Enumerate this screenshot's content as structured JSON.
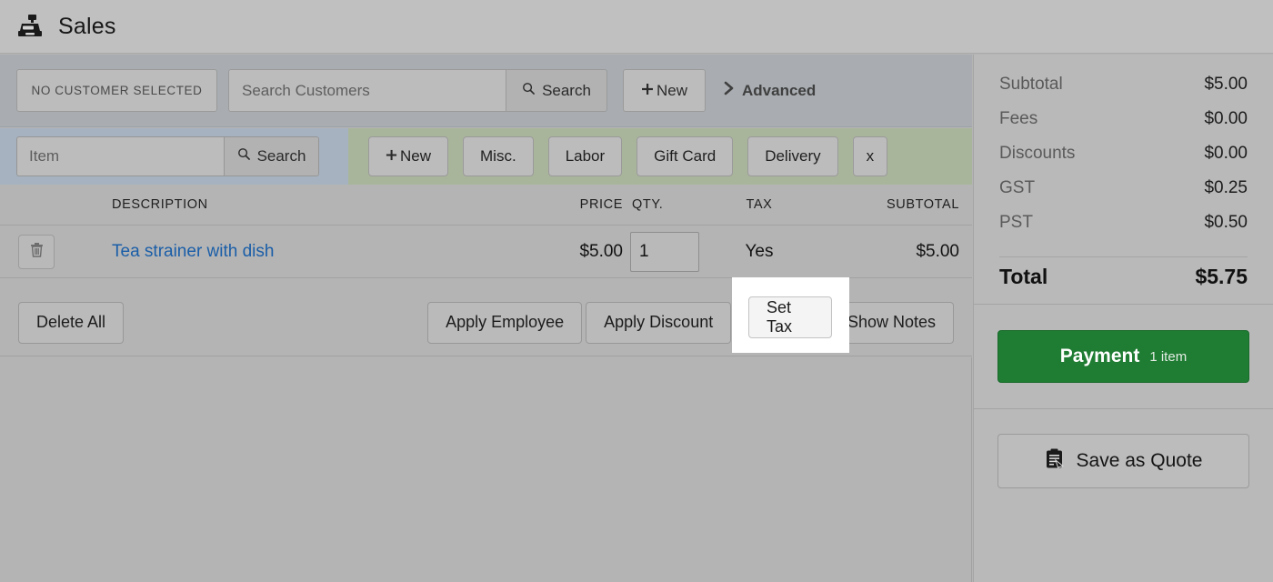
{
  "header": {
    "title": "Sales",
    "icon": "cash-register-icon"
  },
  "customer_bar": {
    "no_customer_label": "NO CUSTOMER SELECTED",
    "search_placeholder": "Search Customers",
    "search_value": "",
    "search_button": "Search",
    "search_icon": "magnifier-icon",
    "new_button": "New",
    "new_icon": "plus-icon",
    "advanced_label": "Advanced",
    "advanced_icon": "chevron-right-icon"
  },
  "item_bar": {
    "item_placeholder": "Item",
    "item_value": "",
    "search_button": "Search",
    "search_icon": "magnifier-icon",
    "buttons": [
      {
        "label": "New",
        "icon": "plus-icon"
      },
      {
        "label": "Misc.",
        "icon": ""
      },
      {
        "label": "Labor",
        "icon": ""
      },
      {
        "label": "Gift Card",
        "icon": ""
      },
      {
        "label": "Delivery",
        "icon": ""
      },
      {
        "label": "x",
        "icon": ""
      }
    ]
  },
  "table": {
    "headers": {
      "description": "DESCRIPTION",
      "price": "PRICE",
      "qty": "QTY.",
      "tax": "TAX",
      "subtotal": "SUBTOTAL"
    },
    "rows": [
      {
        "delete_icon": "trash-icon",
        "description": "Tea strainer with dish",
        "price": "$5.00",
        "qty": "1",
        "tax": "Yes",
        "subtotal": "$5.00"
      }
    ]
  },
  "actions": {
    "delete_all": "Delete All",
    "apply_employee": "Apply Employee",
    "apply_discount": "Apply Discount",
    "set_tax": "Set Tax",
    "show_notes": "Show Notes",
    "highlighted": "Set Tax"
  },
  "sidebar": {
    "totals": [
      {
        "label": "Subtotal",
        "value": "$5.00"
      },
      {
        "label": "Fees",
        "value": "$0.00"
      },
      {
        "label": "Discounts",
        "value": "$0.00"
      },
      {
        "label": "GST",
        "value": "$0.25"
      },
      {
        "label": "PST",
        "value": "$0.50"
      }
    ],
    "grand_total": {
      "label": "Total",
      "value": "$5.75"
    },
    "payment": {
      "label": "Payment",
      "count": "1 item",
      "color": "#1f7c33"
    },
    "quote": {
      "label": "Save as Quote",
      "icon": "clipboard-quote-icon"
    }
  },
  "colors": {
    "page_bg": "#b4b4b4",
    "header_bg": "#c0c0c0",
    "customer_bar_bg": "#a9adb1",
    "item_bar_left_bg": "#a6b2c0",
    "item_bar_right_bg": "#a9b59b",
    "sidebar_bg": "#b9b9b9",
    "link_blue": "#1a5ea8",
    "payment_green": "#1f7c33",
    "spotlight": "#ffffff"
  }
}
